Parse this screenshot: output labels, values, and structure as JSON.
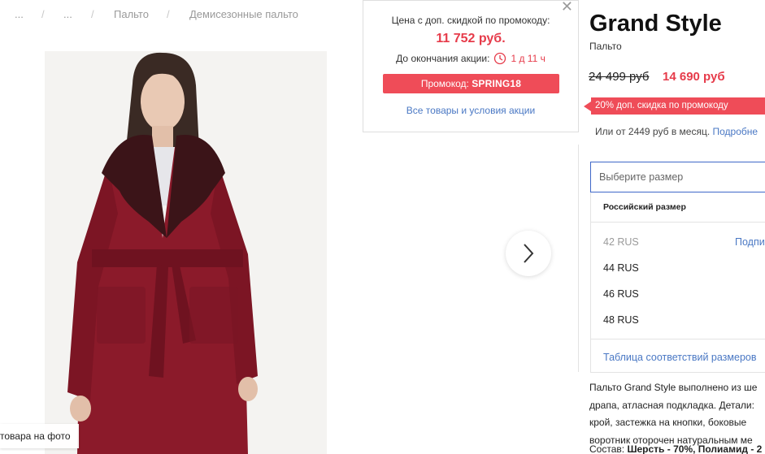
{
  "breadcrumbs": [
    "...",
    "...",
    "Пальто",
    "Демисезонные пальто"
  ],
  "photo": {
    "hint": "товара на фото"
  },
  "promo": {
    "label": "Цена с доп. скидкой по промокоду:",
    "price": "11 752 руб.",
    "timer_label": "До окончания акции:",
    "timer_value": "1 д 11 ч",
    "code_prefix": "Промокод:",
    "code": "SPRING18",
    "link": "Все товары и условия акции"
  },
  "product": {
    "brand": "Grand Style",
    "category": "Пальто",
    "price_old": "24 499 руб",
    "price_new": "14 690 руб",
    "discount_badge": "20% доп. скидка по промокоду",
    "installment_text": "Или от 2449 руб в месяц.",
    "installment_link": "Подробне"
  },
  "size": {
    "placeholder": "Выберите размер",
    "header": "Российский размер",
    "options": [
      {
        "label": "42 RUS",
        "available": false
      },
      {
        "label": "44 RUS",
        "available": true
      },
      {
        "label": "46 RUS",
        "available": true
      },
      {
        "label": "48 RUS",
        "available": true
      }
    ],
    "notify": "Подпи",
    "table_link": "Таблица соответствий размеров"
  },
  "description": {
    "lines": [
      "Пальто Grand Style выполнено из ше",
      "драпа, атласная подкладка. Детали:",
      "крой, застежка на кнопки, боковые",
      "воротник оторочен натуральным ме"
    ],
    "composition_label": "Состав:",
    "composition_value": "Шерсть - 70%, Полиамид - 2"
  },
  "colors": {
    "accent_red": "#ef4c58",
    "price_red": "#e63b4a",
    "link_blue": "#4a78c4",
    "coat": "#8b1a2a"
  }
}
